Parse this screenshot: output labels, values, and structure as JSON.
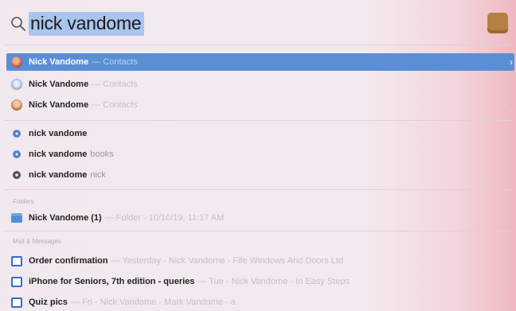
{
  "search": {
    "query": "nick vandome"
  },
  "top_results": [
    {
      "title": "Nick Vandome",
      "subtitle": "— Contacts",
      "icon": "contact-photo-icon"
    },
    {
      "title": "Nick Vandome",
      "subtitle": "— Contacts",
      "icon": "contact-photo-icon"
    },
    {
      "title": "Nick Vandome",
      "subtitle": "— Contacts",
      "icon": "contact-photo-icon"
    }
  ],
  "suggestions": [
    {
      "bold": "nick vandome",
      "extra": ""
    },
    {
      "bold": "nick vandome",
      "extra": "books"
    },
    {
      "bold": "nick vandome",
      "extra": "nick"
    }
  ],
  "folders": {
    "label": "Folders",
    "items": [
      {
        "title": "Nick Vandome (1)",
        "subtitle": "— Folder - 10/10/19, 11:17 AM"
      }
    ]
  },
  "mail": {
    "label": "Mail & Messages",
    "items": [
      {
        "title": "Order confirmation",
        "subtitle": "— Yesterday - Nick Vandome - Fife Windows And Doors Ltd"
      },
      {
        "title": "iPhone for Seniors, 7th edition - queries",
        "subtitle": "— Tue - Nick Vandome - In Easy Steps"
      },
      {
        "title": "Quiz pics",
        "subtitle": "— Fri - Nick Vandome - Mark Vandome - a"
      }
    ]
  },
  "chevron": "›"
}
